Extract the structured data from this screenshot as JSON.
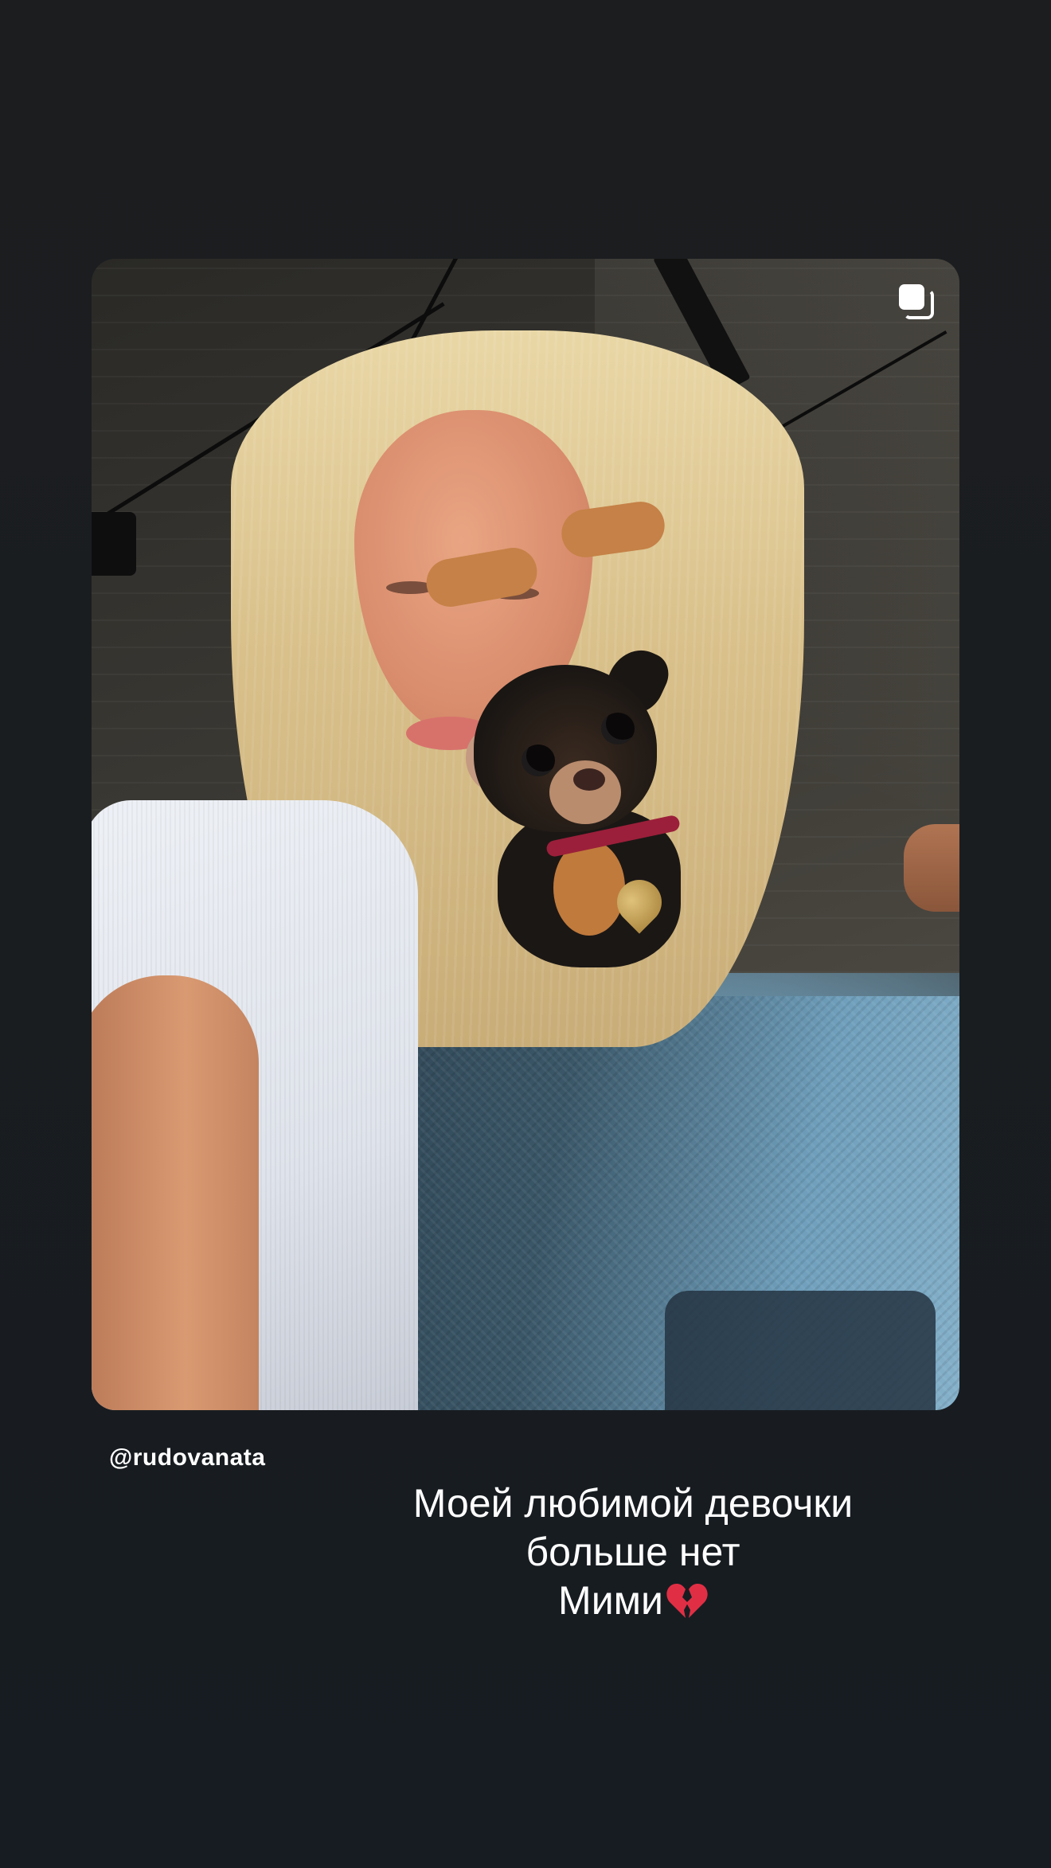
{
  "story": {
    "post_card": {
      "multiple_media_icon": "stacked-squares-icon",
      "image_subject": "photo"
    },
    "username_sticker": "@rudovanata",
    "caption": {
      "line1": "Моей любимой девочки",
      "line2": "больше нет",
      "line3": "Мими",
      "emoji": "broken-heart-icon"
    }
  },
  "colors": {
    "background": "#1c1d1f",
    "text": "#ffffff",
    "heart": "#e02f45"
  }
}
